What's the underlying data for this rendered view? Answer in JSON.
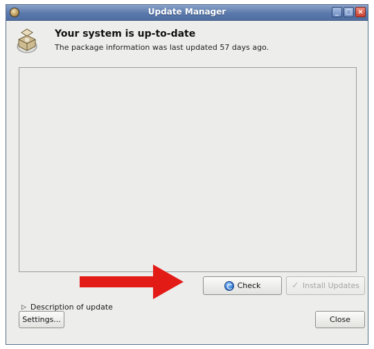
{
  "window": {
    "title": "Update Manager",
    "icons": {
      "app": "update-manager-app-icon",
      "minimize": "minimize-icon",
      "maximize": "maximize-icon",
      "close": "close-window-icon"
    }
  },
  "header": {
    "title": "Your system is up-to-date",
    "subtitle": "The package information was last updated 57 days ago.",
    "icon": "package-box-icon"
  },
  "buttons": {
    "check": "Check",
    "install": "Install Updates",
    "settings": "Settings...",
    "close": "Close"
  },
  "expander": {
    "label": "Description of update",
    "icon": "expander-triangle-icon"
  },
  "overlay": {
    "arrow_color": "#e31b17"
  },
  "colors": {
    "titlebar": "#5b79ab",
    "window_bg": "#ededeb"
  }
}
